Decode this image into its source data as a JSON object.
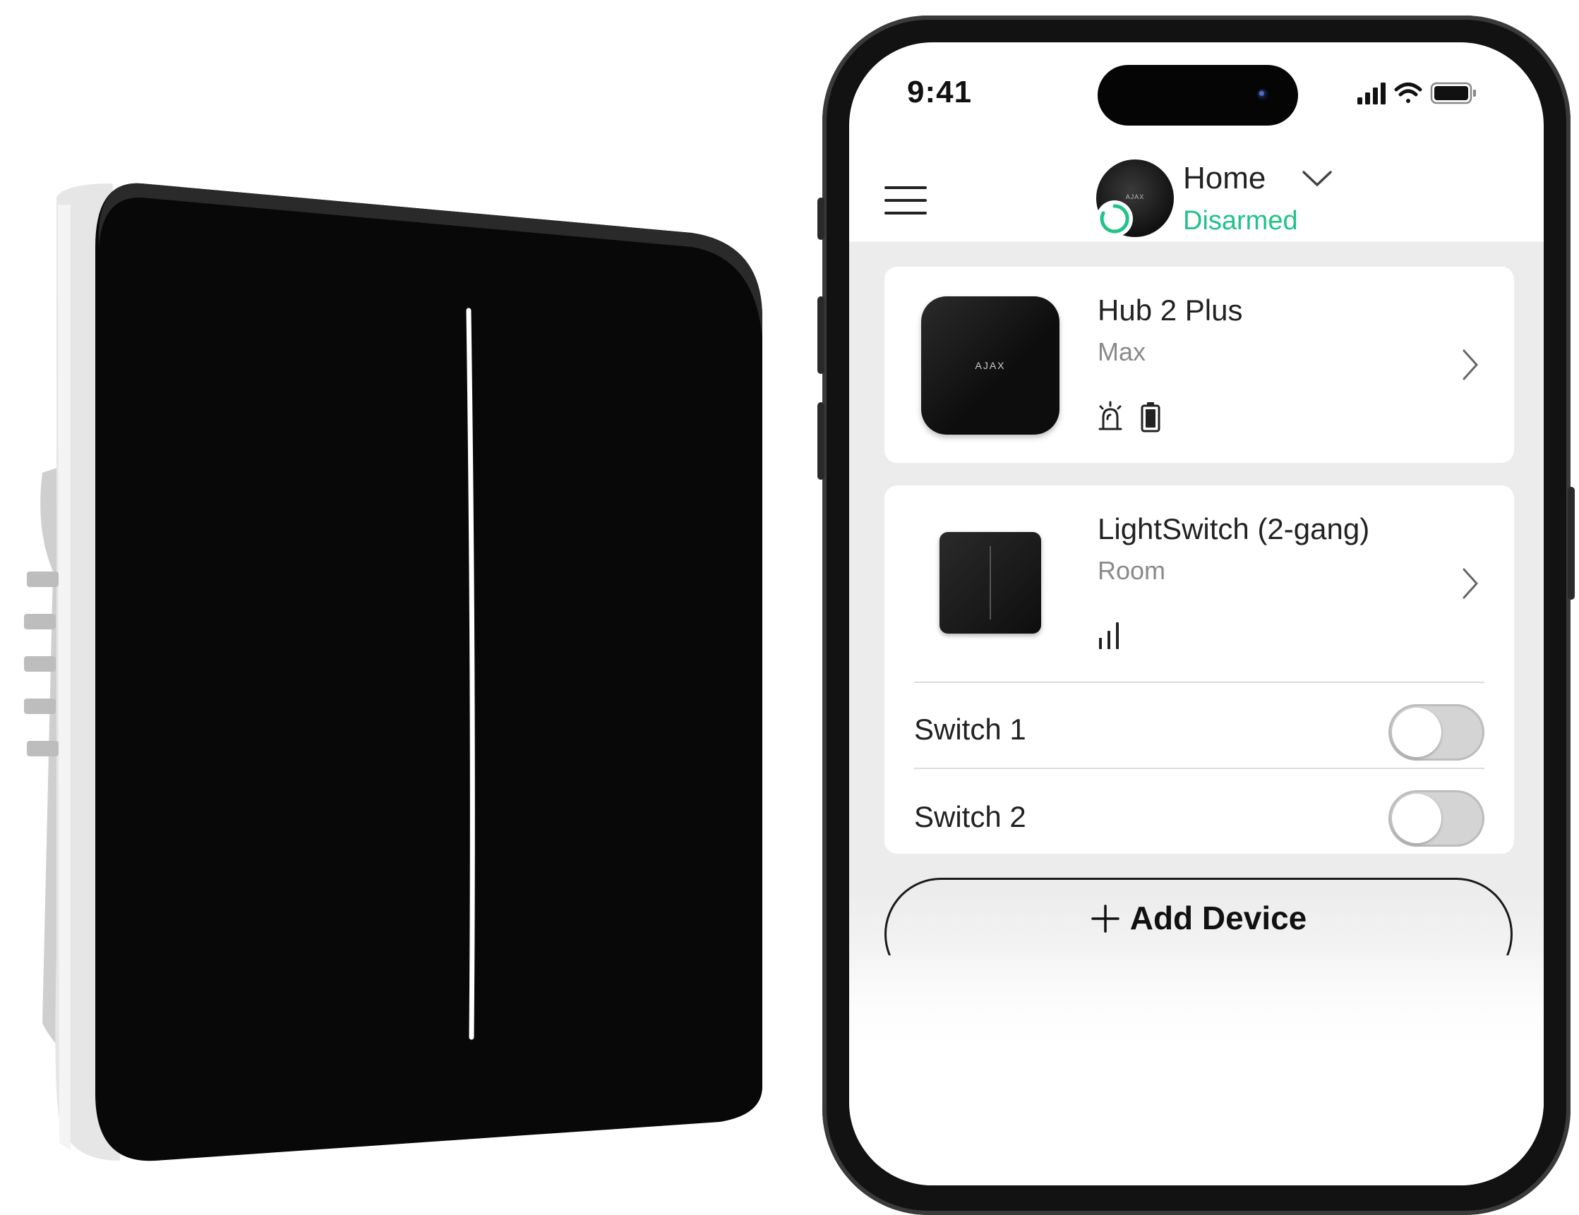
{
  "status_bar": {
    "time": "9:41"
  },
  "header": {
    "hub_name": "Home",
    "arm_state": "Disarmed",
    "hub_logo": "AJAX"
  },
  "devices": [
    {
      "name": "Hub 2 Plus",
      "room": "Max",
      "logo": "AJAX",
      "status_icons": [
        "siren-icon",
        "battery-icon"
      ]
    },
    {
      "name": "LightSwitch (2-gang)",
      "room": "Room",
      "status_icons": [
        "signal-strength-icon"
      ]
    }
  ],
  "switches": [
    {
      "label": "Switch 1",
      "on": false
    },
    {
      "label": "Switch 2",
      "on": false
    }
  ],
  "add_button": {
    "label": "Add Device"
  },
  "colors": {
    "accent_green": "#22c389",
    "card_background": "#ffffff",
    "list_background": "#ececec",
    "toggle_off": "#d4d4d4"
  }
}
